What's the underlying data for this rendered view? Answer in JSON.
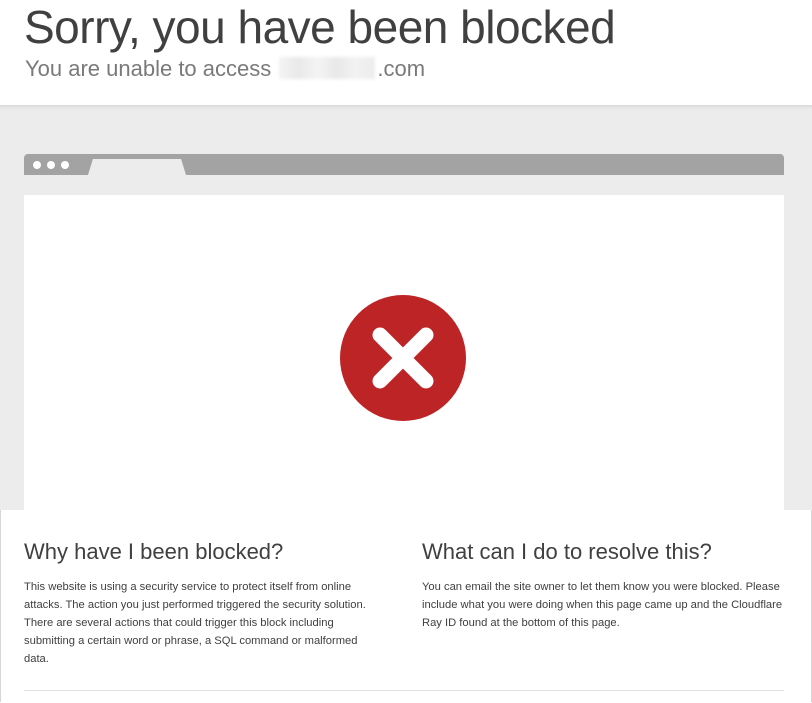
{
  "header": {
    "headline": "Sorry, you have been blocked",
    "subhead_prefix": "You are unable to access",
    "subhead_suffix": ".com"
  },
  "illustration": {
    "status_icon": "x-circle-icon",
    "status_color": "#bd2426",
    "browser_bar_color": "#a3a3a3"
  },
  "why": {
    "title": "Why have I been blocked?",
    "body": "This website is using a security service to protect itself from online attacks. The action you just performed triggered the security solution. There are several actions that could trigger this block including submitting a certain word or phrase, a SQL command or malformed data."
  },
  "resolve": {
    "title": "What can I do to resolve this?",
    "body": "You can email the site owner to let them know you were blocked. Please include what you were doing when this page came up and the Cloudflare Ray ID found at the bottom of this page."
  }
}
